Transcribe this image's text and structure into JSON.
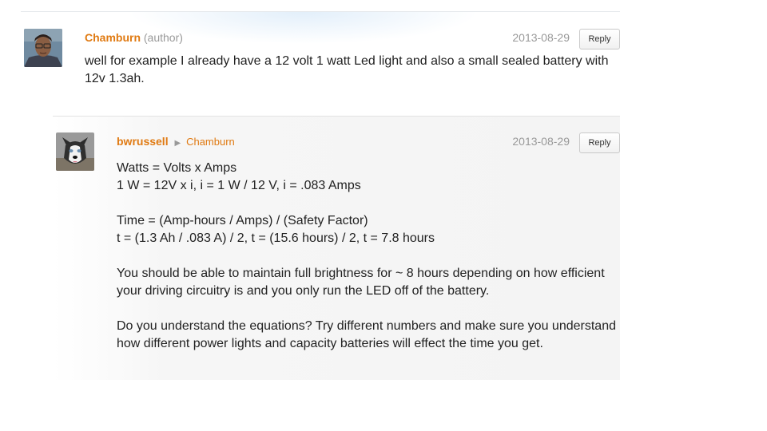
{
  "comments": [
    {
      "author": "Chamburn",
      "role": "(author)",
      "date": "2013-08-29",
      "reply_label": "Reply",
      "body": [
        "well for example I already have a 12 volt 1 watt Led light and also a small sealed battery with 12v 1.3ah."
      ]
    },
    {
      "author": "bwrussell",
      "reply_to": "Chamburn",
      "date": "2013-08-29",
      "reply_label": "Reply",
      "body": [
        "Watts = Volts x Amps",
        "1 W = 12V x i, i = 1 W / 12 V, i = .083 Amps",
        "Time = (Amp-hours / Amps) / (Safety Factor)",
        "t = (1.3 Ah / .083 A) / 2, t = (15.6 hours) / 2, t = 7.8 hours",
        "You should be able to maintain full brightness for ~ 8 hours depending on how efficient your driving circuitry is and you only run the LED off of the battery.",
        "Do you understand the equations? Try different numbers and make sure you understand how different power lights and capacity batteries will effect the time you get."
      ]
    }
  ],
  "icons": {
    "reply_arrow": "triangle-right-icon"
  }
}
